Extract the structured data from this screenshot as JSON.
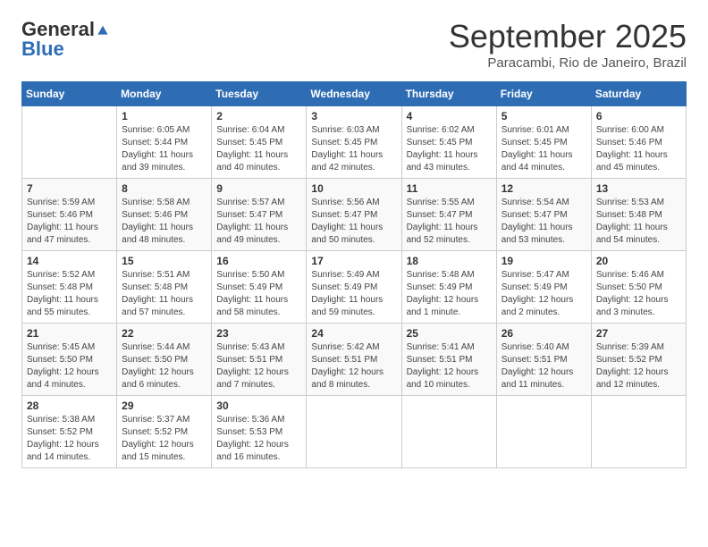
{
  "header": {
    "logo_general": "General",
    "logo_blue": "Blue",
    "month_title": "September 2025",
    "subtitle": "Paracambi, Rio de Janeiro, Brazil"
  },
  "weekdays": [
    "Sunday",
    "Monday",
    "Tuesday",
    "Wednesday",
    "Thursday",
    "Friday",
    "Saturday"
  ],
  "weeks": [
    [
      {
        "day": "",
        "sunrise": "",
        "sunset": "",
        "daylight": ""
      },
      {
        "day": "1",
        "sunrise": "Sunrise: 6:05 AM",
        "sunset": "Sunset: 5:44 PM",
        "daylight": "Daylight: 11 hours and 39 minutes."
      },
      {
        "day": "2",
        "sunrise": "Sunrise: 6:04 AM",
        "sunset": "Sunset: 5:45 PM",
        "daylight": "Daylight: 11 hours and 40 minutes."
      },
      {
        "day": "3",
        "sunrise": "Sunrise: 6:03 AM",
        "sunset": "Sunset: 5:45 PM",
        "daylight": "Daylight: 11 hours and 42 minutes."
      },
      {
        "day": "4",
        "sunrise": "Sunrise: 6:02 AM",
        "sunset": "Sunset: 5:45 PM",
        "daylight": "Daylight: 11 hours and 43 minutes."
      },
      {
        "day": "5",
        "sunrise": "Sunrise: 6:01 AM",
        "sunset": "Sunset: 5:45 PM",
        "daylight": "Daylight: 11 hours and 44 minutes."
      },
      {
        "day": "6",
        "sunrise": "Sunrise: 6:00 AM",
        "sunset": "Sunset: 5:46 PM",
        "daylight": "Daylight: 11 hours and 45 minutes."
      }
    ],
    [
      {
        "day": "7",
        "sunrise": "Sunrise: 5:59 AM",
        "sunset": "Sunset: 5:46 PM",
        "daylight": "Daylight: 11 hours and 47 minutes."
      },
      {
        "day": "8",
        "sunrise": "Sunrise: 5:58 AM",
        "sunset": "Sunset: 5:46 PM",
        "daylight": "Daylight: 11 hours and 48 minutes."
      },
      {
        "day": "9",
        "sunrise": "Sunrise: 5:57 AM",
        "sunset": "Sunset: 5:47 PM",
        "daylight": "Daylight: 11 hours and 49 minutes."
      },
      {
        "day": "10",
        "sunrise": "Sunrise: 5:56 AM",
        "sunset": "Sunset: 5:47 PM",
        "daylight": "Daylight: 11 hours and 50 minutes."
      },
      {
        "day": "11",
        "sunrise": "Sunrise: 5:55 AM",
        "sunset": "Sunset: 5:47 PM",
        "daylight": "Daylight: 11 hours and 52 minutes."
      },
      {
        "day": "12",
        "sunrise": "Sunrise: 5:54 AM",
        "sunset": "Sunset: 5:47 PM",
        "daylight": "Daylight: 11 hours and 53 minutes."
      },
      {
        "day": "13",
        "sunrise": "Sunrise: 5:53 AM",
        "sunset": "Sunset: 5:48 PM",
        "daylight": "Daylight: 11 hours and 54 minutes."
      }
    ],
    [
      {
        "day": "14",
        "sunrise": "Sunrise: 5:52 AM",
        "sunset": "Sunset: 5:48 PM",
        "daylight": "Daylight: 11 hours and 55 minutes."
      },
      {
        "day": "15",
        "sunrise": "Sunrise: 5:51 AM",
        "sunset": "Sunset: 5:48 PM",
        "daylight": "Daylight: 11 hours and 57 minutes."
      },
      {
        "day": "16",
        "sunrise": "Sunrise: 5:50 AM",
        "sunset": "Sunset: 5:49 PM",
        "daylight": "Daylight: 11 hours and 58 minutes."
      },
      {
        "day": "17",
        "sunrise": "Sunrise: 5:49 AM",
        "sunset": "Sunset: 5:49 PM",
        "daylight": "Daylight: 11 hours and 59 minutes."
      },
      {
        "day": "18",
        "sunrise": "Sunrise: 5:48 AM",
        "sunset": "Sunset: 5:49 PM",
        "daylight": "Daylight: 12 hours and 1 minute."
      },
      {
        "day": "19",
        "sunrise": "Sunrise: 5:47 AM",
        "sunset": "Sunset: 5:49 PM",
        "daylight": "Daylight: 12 hours and 2 minutes."
      },
      {
        "day": "20",
        "sunrise": "Sunrise: 5:46 AM",
        "sunset": "Sunset: 5:50 PM",
        "daylight": "Daylight: 12 hours and 3 minutes."
      }
    ],
    [
      {
        "day": "21",
        "sunrise": "Sunrise: 5:45 AM",
        "sunset": "Sunset: 5:50 PM",
        "daylight": "Daylight: 12 hours and 4 minutes."
      },
      {
        "day": "22",
        "sunrise": "Sunrise: 5:44 AM",
        "sunset": "Sunset: 5:50 PM",
        "daylight": "Daylight: 12 hours and 6 minutes."
      },
      {
        "day": "23",
        "sunrise": "Sunrise: 5:43 AM",
        "sunset": "Sunset: 5:51 PM",
        "daylight": "Daylight: 12 hours and 7 minutes."
      },
      {
        "day": "24",
        "sunrise": "Sunrise: 5:42 AM",
        "sunset": "Sunset: 5:51 PM",
        "daylight": "Daylight: 12 hours and 8 minutes."
      },
      {
        "day": "25",
        "sunrise": "Sunrise: 5:41 AM",
        "sunset": "Sunset: 5:51 PM",
        "daylight": "Daylight: 12 hours and 10 minutes."
      },
      {
        "day": "26",
        "sunrise": "Sunrise: 5:40 AM",
        "sunset": "Sunset: 5:51 PM",
        "daylight": "Daylight: 12 hours and 11 minutes."
      },
      {
        "day": "27",
        "sunrise": "Sunrise: 5:39 AM",
        "sunset": "Sunset: 5:52 PM",
        "daylight": "Daylight: 12 hours and 12 minutes."
      }
    ],
    [
      {
        "day": "28",
        "sunrise": "Sunrise: 5:38 AM",
        "sunset": "Sunset: 5:52 PM",
        "daylight": "Daylight: 12 hours and 14 minutes."
      },
      {
        "day": "29",
        "sunrise": "Sunrise: 5:37 AM",
        "sunset": "Sunset: 5:52 PM",
        "daylight": "Daylight: 12 hours and 15 minutes."
      },
      {
        "day": "30",
        "sunrise": "Sunrise: 5:36 AM",
        "sunset": "Sunset: 5:53 PM",
        "daylight": "Daylight: 12 hours and 16 minutes."
      },
      {
        "day": "",
        "sunrise": "",
        "sunset": "",
        "daylight": ""
      },
      {
        "day": "",
        "sunrise": "",
        "sunset": "",
        "daylight": ""
      },
      {
        "day": "",
        "sunrise": "",
        "sunset": "",
        "daylight": ""
      },
      {
        "day": "",
        "sunrise": "",
        "sunset": "",
        "daylight": ""
      }
    ]
  ]
}
